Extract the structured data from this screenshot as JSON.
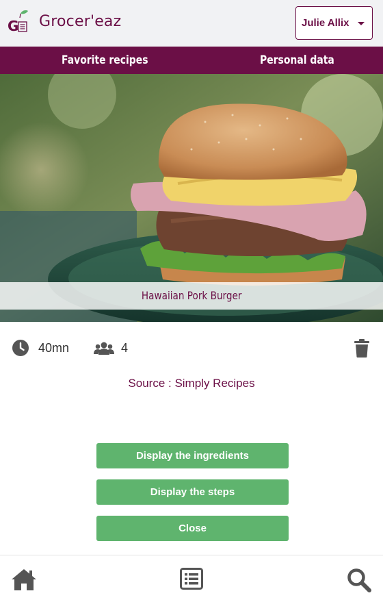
{
  "header": {
    "brand": "Grocer'eaz",
    "user": "Julie Allix"
  },
  "nav": {
    "favorite": "Favorite recipes",
    "personal": "Personal data"
  },
  "recipe": {
    "title": "Hawaiian Pork Burger",
    "time": "40mn",
    "servings": "4",
    "source": "Source : Simply Recipes"
  },
  "buttons": {
    "ingredients": "Display the ingredients",
    "steps": "Display the steps",
    "close": "Close"
  },
  "footer": {
    "icons": [
      "home-icon",
      "list-icon",
      "search-icon"
    ]
  },
  "colors": {
    "brand": "#6b0f46",
    "button": "#5fb46e",
    "header_bg": "#f1f2f4"
  }
}
